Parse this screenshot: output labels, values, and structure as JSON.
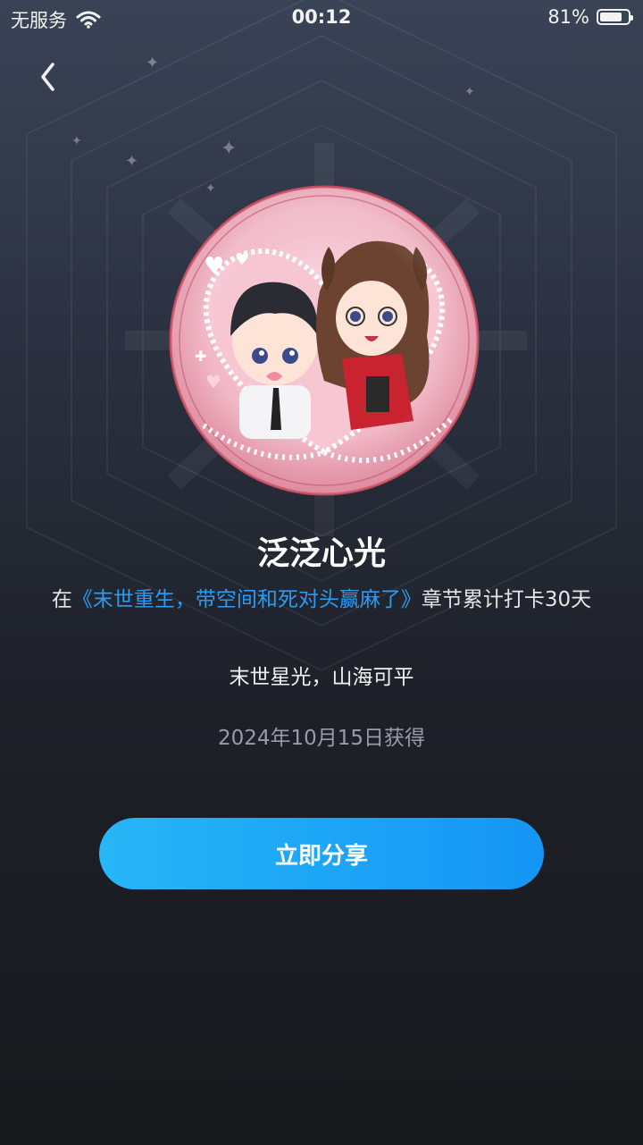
{
  "status": {
    "carrier": "无服务",
    "time": "00:12",
    "battery": "81%",
    "battery_level": 0.81
  },
  "badge": {
    "name": "泛泛心光",
    "desc_prefix": "在",
    "book_title": "《末世重生，带空间和死对头赢麻了》",
    "desc_suffix": "章节累计打卡30天",
    "motto": "末世星光，山海可平",
    "obtained": "2024年10月15日获得"
  },
  "actions": {
    "share_label": "立即分享"
  },
  "colors": {
    "accent": "#1595f5",
    "link": "#2b9cf2"
  }
}
